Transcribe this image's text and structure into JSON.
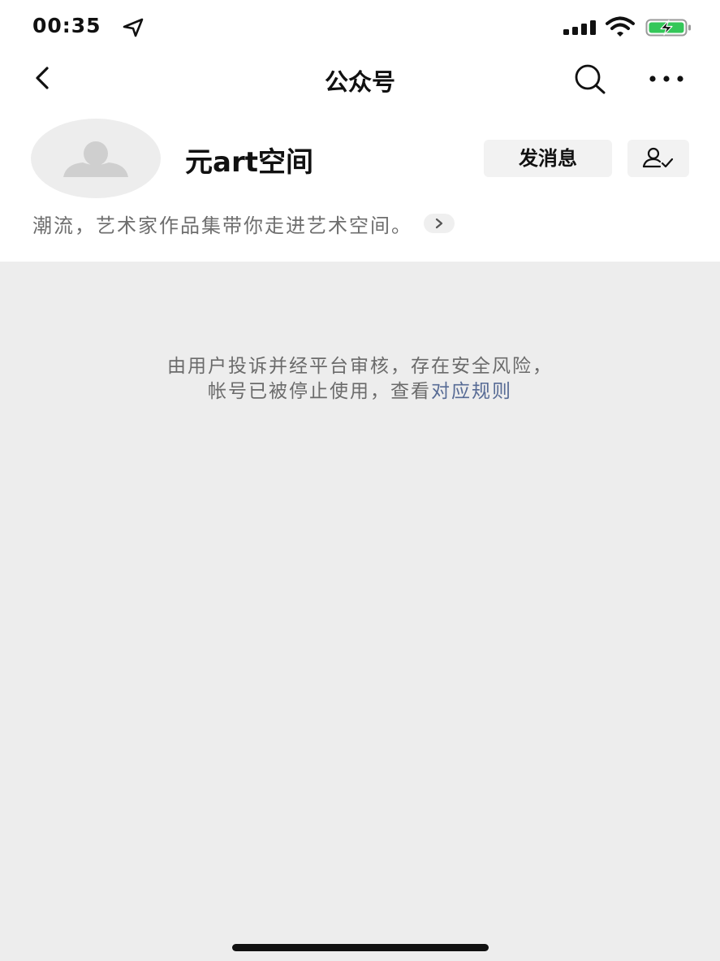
{
  "status_bar": {
    "time": "00:35",
    "icons": [
      "location-arrow-icon",
      "cellular-signal-icon",
      "wifi-icon",
      "battery-charging-icon"
    ]
  },
  "nav": {
    "title": "公众号",
    "back_icon": "chevron-left-icon",
    "search_icon": "search-icon",
    "more_icon": "more-dots-icon"
  },
  "profile": {
    "name": "元art空间",
    "send_message_label": "发消息",
    "follow_icon": "user-check-icon",
    "description": "潮流，艺术家作品集带你走进艺术空间。",
    "description_chevron_icon": "chevron-right-icon"
  },
  "notice": {
    "line1": "由用户投诉并经平台审核，存在安全风险，",
    "line2_prefix": "帐号已被停止使用，查看",
    "rules_link": "对应规则"
  },
  "colors": {
    "page_background": "#ededed",
    "header_background": "#ffffff",
    "link": "#576b95",
    "battery_fill": "#34c759"
  }
}
